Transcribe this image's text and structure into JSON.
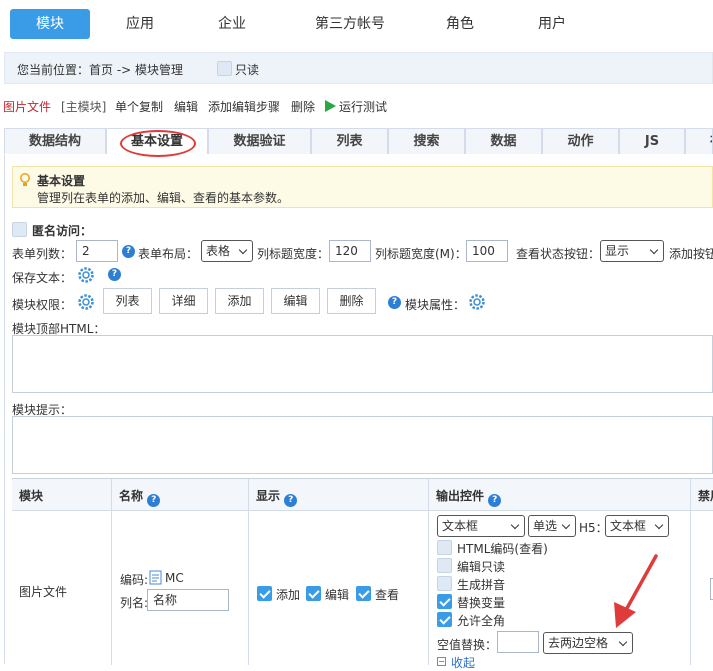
{
  "topnav": {
    "tabs": [
      "模块",
      "应用",
      "企业",
      "第三方帐号",
      "角色",
      "用户"
    ]
  },
  "crumb": {
    "text": "您当前位置：首页 -> 模块管理",
    "readonly_label": "只读"
  },
  "toolbar": {
    "module_name": "图片文件",
    "main_module": "[主模块]",
    "copy": "单个复制",
    "edit": "编辑",
    "add_step": "添加编辑步骤",
    "delete": "删除",
    "run_test": "运行测试"
  },
  "subtabs": [
    "数据结构",
    "基本设置",
    "数据验证",
    "列表",
    "搜索",
    "数据",
    "动作",
    "JS",
    "布"
  ],
  "tip": {
    "title": "基本设置",
    "desc": "管理列在表单的添加、编辑、查看的基本参数。"
  },
  "form": {
    "anon_label": "匿名访问：",
    "cols_label": "表单列数：",
    "cols_value": "2",
    "layout_label": "表单布局：",
    "layout_value": "表格",
    "title_width_label": "列标题宽度：",
    "title_width_value": "120",
    "title_width_m_label": "列标题宽度(M)：",
    "title_width_m_value": "100",
    "view_status_label": "查看状态按钮：",
    "view_status_value": "显示",
    "add_btn_label": "添加按钮",
    "save_text_label": "保存文本：",
    "perm_label": "模块权限：",
    "perm_buttons": [
      "列表",
      "详细",
      "添加",
      "编辑",
      "删除"
    ],
    "attr_label": "模块属性：",
    "top_html_label": "模块顶部HTML：",
    "hint_label": "模块提示："
  },
  "table": {
    "headers": [
      "模块",
      "名称",
      "显示",
      "输出控件",
      "禁用"
    ],
    "row": {
      "module": "图片文件",
      "code_label": "编码:",
      "code_value": "MC",
      "colname_label": "列名:",
      "colname_value": "名称",
      "show_options": [
        "添加",
        "编辑",
        "查看"
      ],
      "ctl_type": "文本框",
      "ctl_select": "单选",
      "h5_label": "H5：",
      "h5_value": "文本框",
      "options": [
        {
          "label": "HTML编码(查看)",
          "checked": false
        },
        {
          "label": "编辑只读",
          "checked": false
        },
        {
          "label": "生成拼音",
          "checked": false
        },
        {
          "label": "替换变量",
          "checked": true
        },
        {
          "label": "允许全角",
          "checked": true
        }
      ],
      "empty_replace_label": "空值替换：",
      "trim_value": "去两边空格",
      "collapse_label": "收起"
    }
  },
  "colors": {
    "accent": "#3a9ce6",
    "annotation": "#e03b3b",
    "help": "#2d7fd3",
    "run": "#27a844"
  }
}
